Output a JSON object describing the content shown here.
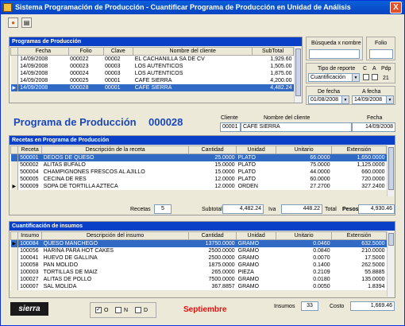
{
  "window": {
    "title": "Sistema Programación de Producción - Cuantificar Programa de Producción en Unidad de Análisis",
    "close": "X"
  },
  "toolbar": {
    "new_icon": "●",
    "print_icon": "▤"
  },
  "programas": {
    "title": "Programas de Producción",
    "columns": [
      "Fecha",
      "Folio",
      "Clave",
      "Nombre del cliente",
      "SubTotal"
    ],
    "rows": [
      [
        "14/09/2008",
        "000022",
        "00002",
        "EL CACHANILLA SA DE CV",
        "1,929.60"
      ],
      [
        "14/09/2008",
        "000023",
        "00003",
        "LOS AUTENTICOS",
        "1,505.00"
      ],
      [
        "14/09/2008",
        "000024",
        "00003",
        "LOS AUTENTICOS",
        "1,875.00"
      ],
      [
        "14/09/2008",
        "000025",
        "00001",
        "CAFE SIERRA",
        "4,200.00"
      ],
      [
        "14/09/2008",
        "000028",
        "00001",
        "CAFE SIERRA",
        "4,482.24"
      ]
    ]
  },
  "filters": {
    "busqueda_label": "Búsqueda x nombre",
    "busqueda_value": "",
    "folio_label": "Folio",
    "folio_value": "",
    "tipo_label": "Tipo de reporte",
    "tipo_value": "Cuantificación",
    "c_label": "C",
    "a_label": "A",
    "pdp_label": "Pdp",
    "pdp_value": "21",
    "de_fecha_label": "De fecha",
    "de_fecha_value": "01/08/2008",
    "a_fecha_label": "A fecha",
    "a_fecha_value": "14/09/2008"
  },
  "programa": {
    "title": "Programa de Producción",
    "folio": "000028",
    "cliente_label": "Cliente",
    "cliente_clave": "00001",
    "nombre_label": "Nombre del cliente",
    "nombre": "CAFE SIERRA",
    "fecha_label": "Fecha",
    "fecha": "14/09/2008"
  },
  "recetas": {
    "title": "Recetas en Programa de Producción",
    "columns": [
      "Receta",
      "Descripción de la receta",
      "Cantidad",
      "Unidad",
      "Unitario",
      "Extensión"
    ],
    "rows": [
      [
        "500001",
        "DEDOS DE QUESO",
        "25.0000",
        "PLATO",
        "66.0000",
        "1,650.0000"
      ],
      [
        "500002",
        "ALITAS BUFALO",
        "15.0000",
        "PLATO",
        "75.0000",
        "1,125.0000"
      ],
      [
        "500004",
        "CHAMPIGNONES FRESCOS AL AJILLO",
        "15.0000",
        "PLATO",
        "44.0000",
        "660.0000"
      ],
      [
        "500005",
        "CECINA DE RES",
        "12.0000",
        "PLATO",
        "60.0000",
        "720.0000"
      ],
      [
        "500009",
        "SOPA DE TORTILLA AZTECA",
        "12.0000",
        "ORDEN",
        "27.2700",
        "327.2400"
      ]
    ],
    "recetas_label": "Recetas",
    "recetas_count": "5",
    "subtotal_label": "Subtotal",
    "subtotal": "4,482.24",
    "iva_label": "Iva",
    "iva": "448.22",
    "total_label": "Total",
    "pesos_label": "Pesos",
    "total": "4,930.46"
  },
  "insumos": {
    "title": "Cuantificación de insumos",
    "columns": [
      "Insumo",
      "Descripción del insumo",
      "Cantidad",
      "Unidad",
      "Unitario",
      "Extensión"
    ],
    "rows": [
      [
        "100084",
        "QUESO MANCHEGO",
        "13750.0000",
        "GRAMO",
        "0.0460",
        "632.5000"
      ],
      [
        "100056",
        "HARINA PARA HOT CAKES",
        "2500.0000",
        "GRAMO",
        "0.0840",
        "210.0000"
      ],
      [
        "100041",
        "HUEVO DE GALLINA",
        "2500.0000",
        "GRAMO",
        "0.0070",
        "17.5000"
      ],
      [
        "100058",
        "PAN MOLIDO",
        "1875.0000",
        "GRAMO",
        "0.1400",
        "262.5000"
      ],
      [
        "100003",
        "TORTILLAS DE MAIZ",
        "265.0000",
        "PIEZA",
        "0.2109",
        "55.8885"
      ],
      [
        "100027",
        "ALITAS DE POLLO",
        "7500.0000",
        "GRAMO",
        "0.0180",
        "135.0000"
      ],
      [
        "100007",
        "SAL MOLIDA",
        "367.8857",
        "GRAMO",
        "0.0050",
        "1.8394"
      ]
    ]
  },
  "footer": {
    "logo": "sierra",
    "o_label": "O",
    "n_label": "N",
    "d_label": "D",
    "month": "Septiembre",
    "insumos_label": "Insumos",
    "insumos_count": "33",
    "costo_label": "Costo",
    "costo": "1,669.46"
  }
}
